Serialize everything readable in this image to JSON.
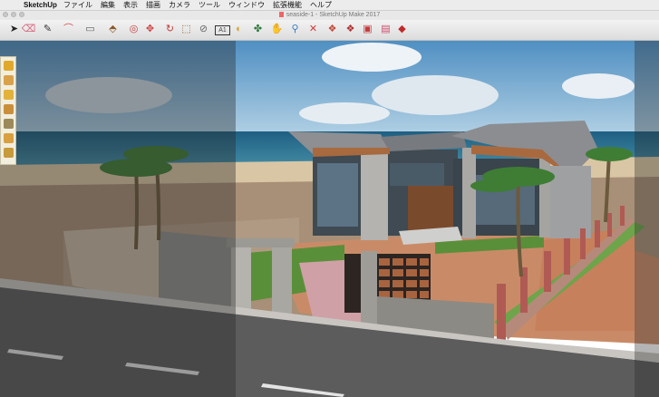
{
  "menubar": {
    "apple_icon": "apple-logo",
    "app_name": "SketchUp",
    "items": [
      "ファイル",
      "編集",
      "表示",
      "描画",
      "カメラ",
      "ツール",
      "ウィンドウ",
      "拡張機能",
      "ヘルプ"
    ]
  },
  "window": {
    "title": "seaside-1 - SketchUp Make 2017"
  },
  "toolbar": {
    "tools": [
      {
        "name": "select-icon",
        "glyph": "➤"
      },
      {
        "name": "eraser-icon",
        "glyph": "⌫"
      },
      {
        "name": "line-icon",
        "glyph": "✎"
      },
      {
        "name": "arc-icon",
        "glyph": "⌒"
      },
      {
        "name": "shape-icon",
        "glyph": "▭"
      },
      {
        "name": "push-pull-icon",
        "glyph": "⬘"
      },
      {
        "name": "offset-icon",
        "glyph": "◎"
      },
      {
        "name": "move-icon",
        "glyph": "✥"
      },
      {
        "name": "rotate-icon",
        "glyph": "↻"
      },
      {
        "name": "scale-icon",
        "glyph": "⬚"
      },
      {
        "name": "tape-measure-icon",
        "glyph": "⊘"
      },
      {
        "name": "text-icon",
        "glyph": "A1"
      },
      {
        "name": "paint-bucket-icon",
        "glyph": "◐"
      },
      {
        "name": "orbit-icon",
        "glyph": "✤"
      },
      {
        "name": "pan-icon",
        "glyph": "✋"
      },
      {
        "name": "zoom-icon",
        "glyph": "⚲"
      },
      {
        "name": "zoom-extents-icon",
        "glyph": "✕"
      },
      {
        "name": "warehouse-icon",
        "glyph": "❖"
      },
      {
        "name": "extension-warehouse-icon",
        "glyph": "❖"
      },
      {
        "name": "share-model-icon",
        "glyph": "▣"
      },
      {
        "name": "layout-icon",
        "glyph": "▤"
      },
      {
        "name": "ruby-icon",
        "glyph": "◆"
      }
    ]
  },
  "left_toolbar": {
    "tools": [
      "standard-views-icon",
      "shadow-icon",
      "light-icon",
      "sandbox-icon",
      "layers-icon",
      "materials-icon",
      "settings-icon"
    ]
  },
  "colors": {
    "sky": "#7fb2d6",
    "sea": "#2a6f8f",
    "road": "#5c5c5c",
    "paving": "#c98b67",
    "grass": "#5a8f3a",
    "wall": "#b8aa98",
    "roof": "#888a8e"
  }
}
